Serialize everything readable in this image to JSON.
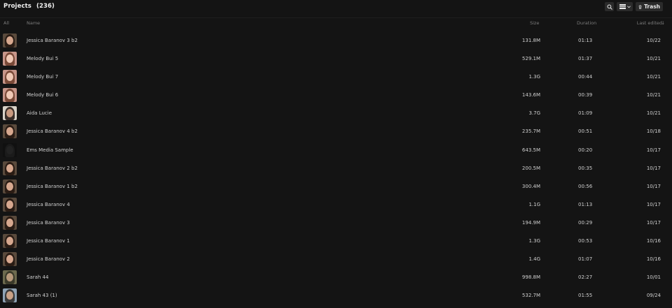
{
  "header": {
    "title": "Projects",
    "count": "(236)",
    "trash_label": "Trash"
  },
  "columns": {
    "all": "All",
    "name": "Name",
    "size": "Size",
    "duration": "Duration",
    "edited": "Last edited",
    "sort_indicator": "↓"
  },
  "icons": {
    "search": "search-icon",
    "view": "list-view-icon",
    "trash": "trash-icon"
  },
  "rows": [
    {
      "name": "Jessica Baranov 3 b2",
      "size": "131.8M",
      "duration": "01:13",
      "edited": "10/22",
      "thumb": "portrait-woman-dark-hair"
    },
    {
      "name": "Melody Bui 5",
      "size": "529.1M",
      "duration": "01:37",
      "edited": "10/21",
      "thumb": "portrait-woman-light"
    },
    {
      "name": "Melody Bui 7",
      "size": "1.3G",
      "duration": "00:44",
      "edited": "10/21",
      "thumb": "portrait-woman-light"
    },
    {
      "name": "Melody Bui 6",
      "size": "143.6M",
      "duration": "00:39",
      "edited": "10/21",
      "thumb": "portrait-woman-light"
    },
    {
      "name": "Aida Lucie",
      "size": "3.7G",
      "duration": "01:09",
      "edited": "10/21",
      "thumb": "portrait-man"
    },
    {
      "name": "Jessica Baranov 4 b2",
      "size": "235.7M",
      "duration": "00:51",
      "edited": "10/18",
      "thumb": "portrait-woman-dark-hair"
    },
    {
      "name": "Ems Media Sample",
      "size": "643.5M",
      "duration": "00:20",
      "edited": "10/17",
      "thumb": "dark-sample"
    },
    {
      "name": "Jessica Baranov 2 b2",
      "size": "200.5M",
      "duration": "00:35",
      "edited": "10/17",
      "thumb": "portrait-woman-dark-hair"
    },
    {
      "name": "Jessica Baranov 1 b2",
      "size": "300.4M",
      "duration": "00:56",
      "edited": "10/17",
      "thumb": "portrait-woman-dark-hair"
    },
    {
      "name": "Jessica Baranov 4",
      "size": "1.1G",
      "duration": "01:13",
      "edited": "10/17",
      "thumb": "portrait-woman-dark-hair"
    },
    {
      "name": "Jessica Baranov 3",
      "size": "194.9M",
      "duration": "00:29",
      "edited": "10/17",
      "thumb": "portrait-woman-dark-hair"
    },
    {
      "name": "Jessica Baranov 1",
      "size": "1.3G",
      "duration": "00:53",
      "edited": "10/16",
      "thumb": "portrait-woman-dark-hair"
    },
    {
      "name": "Jessica Baranov 2",
      "size": "1.4G",
      "duration": "01:07",
      "edited": "10/16",
      "thumb": "portrait-woman-dark-hair"
    },
    {
      "name": "Sarah 44",
      "size": "998.8M",
      "duration": "02:27",
      "edited": "10/01",
      "thumb": "landscape-portrait"
    },
    {
      "name": "Sarah 43 (1)",
      "size": "532.7M",
      "duration": "01:55",
      "edited": "09/24",
      "thumb": "portrait-man-blue"
    }
  ],
  "theme": {
    "background": "#141414",
    "button_bg": "#2b2b2b",
    "text": "#cfcfcf",
    "muted": "#7c7c7c"
  }
}
